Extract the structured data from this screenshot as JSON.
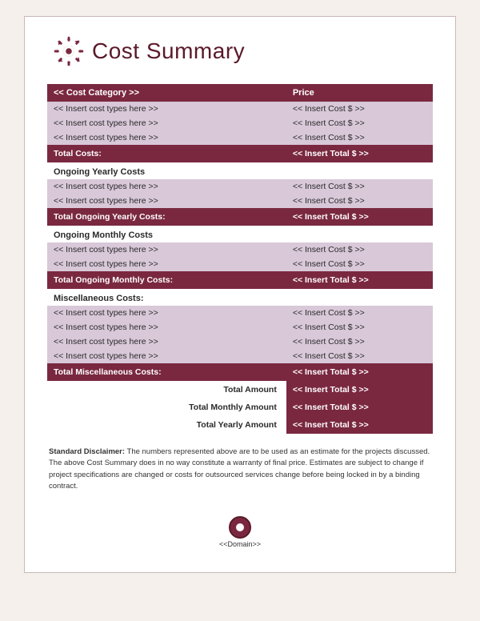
{
  "header": {
    "title": "Cost Summary"
  },
  "table": {
    "col_category": "<< Cost Category >>",
    "col_price": "Price",
    "sections": [
      {
        "type": "header_only"
      },
      {
        "type": "data_rows",
        "rows": [
          {
            "cat": "<< Insert cost types here >>",
            "price": "<< Insert Cost $ >>"
          },
          {
            "cat": "<< Insert cost types here >>",
            "price": "<< Insert Cost $ >>"
          },
          {
            "cat": "<< Insert cost types here >>",
            "price": "<< Insert Cost $ >>"
          }
        ]
      },
      {
        "type": "total",
        "label": "Total Costs:",
        "value": "<< Insert Total $ >>"
      },
      {
        "type": "section_heading",
        "label": "Ongoing Yearly Costs"
      },
      {
        "type": "data_rows",
        "rows": [
          {
            "cat": "<< Insert cost types here >>",
            "price": "<< Insert Cost $ >>"
          },
          {
            "cat": "<< Insert cost types here >>",
            "price": "<< Insert Cost $ >>"
          }
        ]
      },
      {
        "type": "total",
        "label": "Total Ongoing Yearly Costs:",
        "value": "<< Insert Total $ >>"
      },
      {
        "type": "section_heading",
        "label": "Ongoing Monthly Costs"
      },
      {
        "type": "data_rows",
        "rows": [
          {
            "cat": "<< Insert cost types here >>",
            "price": "<< Insert Cost $ >>"
          },
          {
            "cat": "<< Insert cost types here >>",
            "price": "<< Insert Cost $ >>"
          }
        ]
      },
      {
        "type": "total",
        "label": "Total Ongoing Monthly Costs:",
        "value": "<< Insert Total $ >>"
      },
      {
        "type": "section_heading",
        "label": "Miscellaneous Costs:"
      },
      {
        "type": "data_rows",
        "rows": [
          {
            "cat": "<< Insert cost types here >>",
            "price": "<< Insert Cost $ >>"
          },
          {
            "cat": "<< Insert cost types here >>",
            "price": "<< Insert Cost $ >>"
          },
          {
            "cat": "<< Insert cost types here >>",
            "price": "<< Insert Cost $ >>"
          },
          {
            "cat": "<< Insert cost types here >>",
            "price": "<< Insert Cost $ >>"
          }
        ]
      },
      {
        "type": "total",
        "label": "Total Miscellaneous Costs:",
        "value": "<< Insert Total $ >>"
      }
    ],
    "summary": [
      {
        "label": "Total Amount",
        "value": "<< Insert Total $ >>"
      },
      {
        "label": "Total Monthly Amount",
        "value": "<< Insert Total $ >>"
      },
      {
        "label": "Total Yearly Amount",
        "value": "<< Insert Total $ >>"
      }
    ]
  },
  "disclaimer": {
    "bold_part": "Standard Disclaimer:",
    "text": " The numbers represented above are to be used as an estimate for the projects discussed. The above Cost Summary does in no way constitute a warranty of final price. Estimates are subject to change if project specifications are changed or costs for outsourced services change before being locked in by a binding contract."
  },
  "footer": {
    "label": "<<Domain>>"
  }
}
